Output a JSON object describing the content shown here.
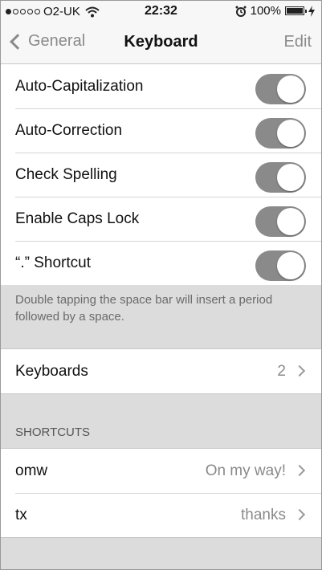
{
  "status_bar": {
    "carrier": "O2-UK",
    "time": "22:32",
    "battery": "100%",
    "signal_icon": "signal-dots-icon",
    "wifi_icon": "wifi-icon",
    "alarm_icon": "alarm-icon",
    "battery_icon": "battery-icon",
    "charging_icon": "charging-bolt-icon"
  },
  "nav": {
    "back_label": "General",
    "title": "Keyboard",
    "edit_label": "Edit"
  },
  "toggles": [
    {
      "label": "Auto-Capitalization",
      "on": true
    },
    {
      "label": "Auto-Correction",
      "on": true
    },
    {
      "label": "Check Spelling",
      "on": true
    },
    {
      "label": "Enable Caps Lock",
      "on": true
    },
    {
      "label": "“.” Shortcut",
      "on": true
    }
  ],
  "shortcut_note": "Double tapping the space bar will insert a period followed by a space.",
  "keyboards": {
    "label": "Keyboards",
    "value": "2"
  },
  "shortcuts_header": "SHORTCUTS",
  "shortcuts": [
    {
      "label": "omw",
      "value": "On my way!"
    },
    {
      "label": "tx",
      "value": "thanks"
    }
  ],
  "colors": {
    "toggle_on": "#8a8a8a",
    "background": "#dcdcdc",
    "nav_accent": "#8a8a8a"
  }
}
